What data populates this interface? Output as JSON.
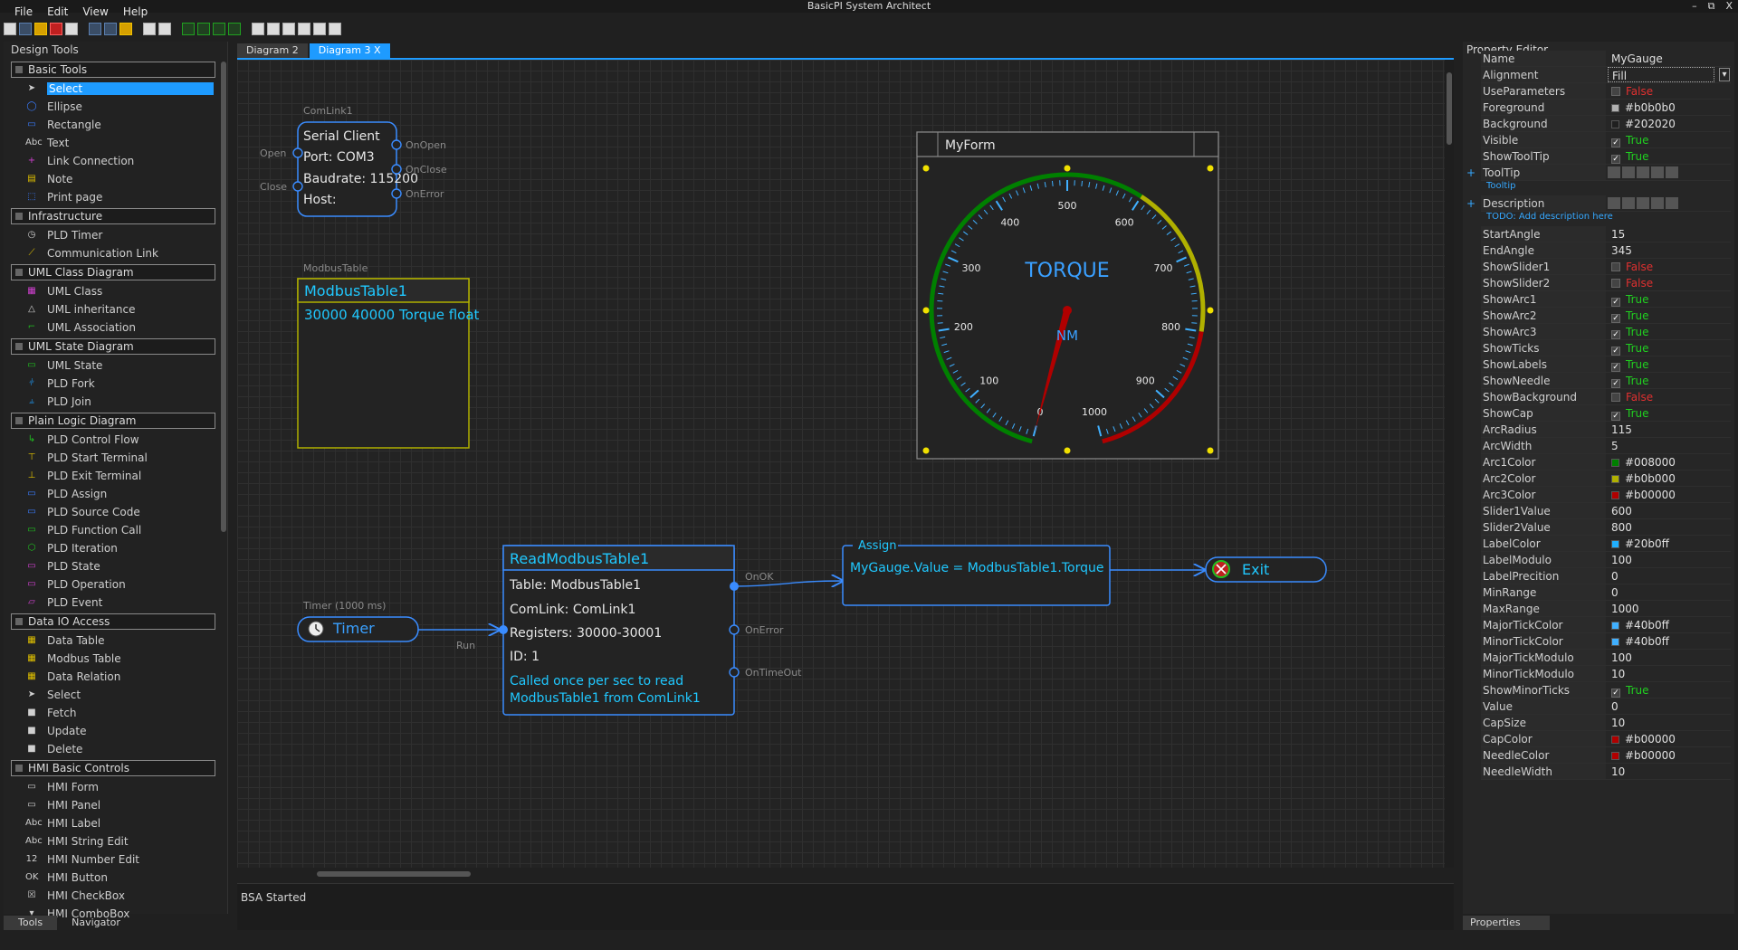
{
  "window": {
    "title": "BasicPI System Architect",
    "minimize": "–",
    "maximize": "⧉",
    "close": "X"
  },
  "menu": [
    "File",
    "Edit",
    "View",
    "Help"
  ],
  "left_panel": {
    "title": "Design Tools",
    "categories": [
      {
        "name": "Basic Tools",
        "items": [
          "Select",
          "Ellipse",
          "Rectangle",
          "Text",
          "Link Connection",
          "Note",
          "Print page"
        ]
      },
      {
        "name": "Infrastructure",
        "items": [
          "PLD Timer",
          "Communication Link"
        ]
      },
      {
        "name": "UML Class Diagram",
        "items": [
          "UML Class",
          "UML inheritance",
          "UML Association"
        ]
      },
      {
        "name": "UML State Diagram",
        "items": [
          "UML State",
          "PLD Fork",
          "PLD Join"
        ]
      },
      {
        "name": "Plain Logic Diagram",
        "items": [
          "PLD Control Flow",
          "PLD Start Terminal",
          "PLD Exit Terminal",
          "PLD Assign",
          "PLD Source Code",
          "PLD Function Call",
          "PLD Iteration",
          "PLD State",
          "PLD Operation",
          "PLD Event"
        ]
      },
      {
        "name": "Data IO Access",
        "items": [
          "Data Table",
          "Modbus Table",
          "Data Relation",
          "Select",
          "Fetch",
          "Update",
          "Delete"
        ]
      },
      {
        "name": "HMI Basic Controls",
        "items": [
          "HMI Form",
          "HMI Panel",
          "HMI Label",
          "HMI String Edit",
          "HMI Number Edit",
          "HMI Button",
          "HMI CheckBox",
          "HMI ComboBox"
        ]
      }
    ],
    "tabs": [
      "Tools",
      "Navigator"
    ]
  },
  "doc_tabs": [
    "Diagram 2",
    "Diagram 3  X"
  ],
  "diagram": {
    "comlink": {
      "caption": "ComLink1",
      "title": "Serial Client",
      "lines": [
        "Port: COM3",
        "Baudrate: 115200",
        "Host:"
      ],
      "in_ports": [
        "Open",
        "Close"
      ],
      "out_ports": [
        "OnOpen",
        "OnClose",
        "OnError"
      ]
    },
    "modbus": {
      "caption": "ModbusTable",
      "title": "ModbusTable1",
      "body": "30000 40000 Torque float"
    },
    "form": {
      "title": "MyForm",
      "gauge_title": "TORQUE",
      "gauge_unit": "NM",
      "labels": [
        "0",
        "100",
        "200",
        "300",
        "400",
        "500",
        "600",
        "700",
        "800",
        "900",
        "1000"
      ]
    },
    "timer": {
      "caption": "Timer (1000 ms)",
      "label": "Timer",
      "port": "Run"
    },
    "read": {
      "title": "ReadModbusTable1",
      "lines": [
        "Table: ModbusTable1",
        "ComLink: ComLink1",
        "Registers: 30000-30001",
        "ID: 1"
      ],
      "comment1": "Called once per sec to read",
      "comment2": "ModbusTable1 from ComLink1",
      "ports": [
        "OnOK",
        "OnError",
        "OnTimeOut"
      ]
    },
    "assign": {
      "title": "Assign",
      "expr": "MyGauge.Value = ModbusTable1.Torque"
    },
    "exit": {
      "label": "Exit"
    }
  },
  "status": "BSA Started",
  "property_editor": {
    "title": "Property Editor",
    "tab": "Properties",
    "rows": [
      {
        "k": "Name",
        "v": "MyGauge",
        "t": "text"
      },
      {
        "k": "Alignment",
        "v": "Fill",
        "t": "combo"
      },
      {
        "k": "UseParameters",
        "v": "False",
        "t": "bool"
      },
      {
        "k": "Foreground",
        "v": "#b0b0b0",
        "t": "color",
        "c": "#b0b0b0"
      },
      {
        "k": "Background",
        "v": "#202020",
        "t": "color",
        "c": "#202020"
      },
      {
        "k": "Visible",
        "v": "True",
        "t": "bool"
      },
      {
        "k": "ShowToolTip",
        "v": "True",
        "t": "bool"
      },
      {
        "k": "ToolTip",
        "v": "",
        "t": "group",
        "sub": "Tooltip"
      },
      {
        "k": "Description",
        "v": "",
        "t": "group",
        "sub": "TODO: Add description here"
      },
      {
        "k": "StartAngle",
        "v": "15",
        "t": "text"
      },
      {
        "k": "EndAngle",
        "v": "345",
        "t": "text"
      },
      {
        "k": "ShowSlider1",
        "v": "False",
        "t": "bool"
      },
      {
        "k": "ShowSlider2",
        "v": "False",
        "t": "bool"
      },
      {
        "k": "ShowArc1",
        "v": "True",
        "t": "bool"
      },
      {
        "k": "ShowArc2",
        "v": "True",
        "t": "bool"
      },
      {
        "k": "ShowArc3",
        "v": "True",
        "t": "bool"
      },
      {
        "k": "ShowTicks",
        "v": "True",
        "t": "bool"
      },
      {
        "k": "ShowLabels",
        "v": "True",
        "t": "bool"
      },
      {
        "k": "ShowNeedle",
        "v": "True",
        "t": "bool"
      },
      {
        "k": "ShowBackground",
        "v": "False",
        "t": "bool"
      },
      {
        "k": "ShowCap",
        "v": "True",
        "t": "bool"
      },
      {
        "k": "ArcRadius",
        "v": "115",
        "t": "text"
      },
      {
        "k": "ArcWidth",
        "v": "5",
        "t": "text"
      },
      {
        "k": "Arc1Color",
        "v": "#008000",
        "t": "color",
        "c": "#008000"
      },
      {
        "k": "Arc2Color",
        "v": "#b0b000",
        "t": "color",
        "c": "#b0b000"
      },
      {
        "k": "Arc3Color",
        "v": "#b00000",
        "t": "color",
        "c": "#b00000"
      },
      {
        "k": "Slider1Value",
        "v": "600",
        "t": "text"
      },
      {
        "k": "Slider2Value",
        "v": "800",
        "t": "text"
      },
      {
        "k": "LabelColor",
        "v": "#20b0ff",
        "t": "color",
        "c": "#20b0ff"
      },
      {
        "k": "LabelModulo",
        "v": "100",
        "t": "text"
      },
      {
        "k": "LabelPrecition",
        "v": "0",
        "t": "text"
      },
      {
        "k": "MinRange",
        "v": "0",
        "t": "text"
      },
      {
        "k": "MaxRange",
        "v": "1000",
        "t": "text"
      },
      {
        "k": "MajorTickColor",
        "v": "#40b0ff",
        "t": "color",
        "c": "#40b0ff"
      },
      {
        "k": "MinorTickColor",
        "v": "#40b0ff",
        "t": "color",
        "c": "#40b0ff"
      },
      {
        "k": "MajorTickModulo",
        "v": "100",
        "t": "text"
      },
      {
        "k": "MinorTickModulo",
        "v": "10",
        "t": "text"
      },
      {
        "k": "ShowMinorTicks",
        "v": "True",
        "t": "bool"
      },
      {
        "k": "Value",
        "v": "0",
        "t": "text"
      },
      {
        "k": "CapSize",
        "v": "10",
        "t": "text"
      },
      {
        "k": "CapColor",
        "v": "#b00000",
        "t": "color",
        "c": "#b00000"
      },
      {
        "k": "NeedleColor",
        "v": "#b00000",
        "t": "color",
        "c": "#b00000"
      },
      {
        "k": "NeedleWidth",
        "v": "10",
        "t": "text"
      }
    ]
  }
}
